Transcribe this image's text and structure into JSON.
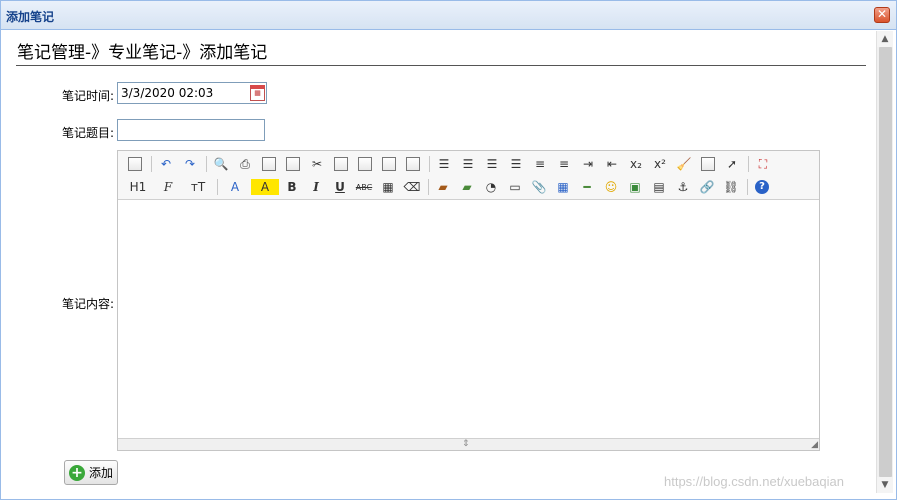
{
  "window": {
    "title": "添加笔记",
    "close_glyph": "✕"
  },
  "breadcrumb": "笔记管理-》专业笔记-》添加笔记",
  "form": {
    "time_label": "笔记时间:",
    "time_value": "3/3/2020 02:03",
    "subject_label": "笔记题目:",
    "subject_value": "",
    "content_label": "笔记内容:"
  },
  "toolbar": {
    "heading_label": "H1",
    "font_label": "F",
    "size_label": "тT",
    "font_color_label": "A",
    "highlight_label": "A",
    "bold": "B",
    "italic": "I",
    "underline": "U",
    "strike": "ABC",
    "subscript": "x₂",
    "superscript": "x²"
  },
  "add_button": {
    "label": "添加",
    "icon": "plus-icon"
  },
  "watermark": "https://blog.csdn.net/xuebaqian",
  "colors": {
    "title": "#15428b",
    "border": "#99bbe8",
    "add_icon": "#3aa83a"
  }
}
